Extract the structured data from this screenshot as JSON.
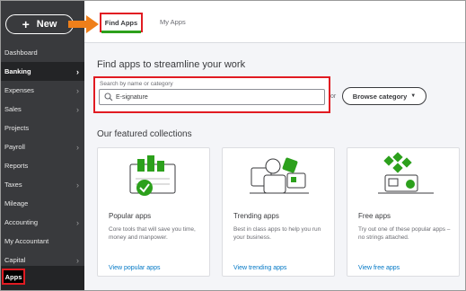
{
  "sidebar": {
    "new_label": "New",
    "items": [
      {
        "label": "Dashboard",
        "chevron": false
      },
      {
        "label": "Banking",
        "chevron": true
      },
      {
        "label": "Expenses",
        "chevron": true
      },
      {
        "label": "Sales",
        "chevron": true
      },
      {
        "label": "Projects",
        "chevron": false
      },
      {
        "label": "Payroll",
        "chevron": true
      },
      {
        "label": "Reports",
        "chevron": false
      },
      {
        "label": "Taxes",
        "chevron": true
      },
      {
        "label": "Mileage",
        "chevron": false
      },
      {
        "label": "Accounting",
        "chevron": true
      },
      {
        "label": "My Accountant",
        "chevron": false
      },
      {
        "label": "Capital",
        "chevron": true
      }
    ],
    "active_item": "Apps"
  },
  "tabs": {
    "find_apps": "Find Apps",
    "my_apps": "My Apps"
  },
  "main": {
    "heading": "Find apps to streamline your work",
    "search_label": "Search by name or category",
    "search_value": "E-signature",
    "or_text": "or",
    "browse_label": "Browse category",
    "collections_heading": "Our featured collections",
    "cards": [
      {
        "title": "Popular apps",
        "desc": "Core tools that will save you time, money and manpower.",
        "link": "View popular apps"
      },
      {
        "title": "Trending apps",
        "desc": "Best in class apps to help you run your business.",
        "link": "View trending apps"
      },
      {
        "title": "Free apps",
        "desc": "Try out one of these popular apps – no strings attached.",
        "link": "View free apps"
      }
    ]
  },
  "colors": {
    "sidebar_bg": "#393a3d",
    "accent_green": "#2ca01c",
    "highlight_red": "#e11b22",
    "arrow_orange": "#ef7f1a",
    "link_blue": "#0077c5"
  }
}
